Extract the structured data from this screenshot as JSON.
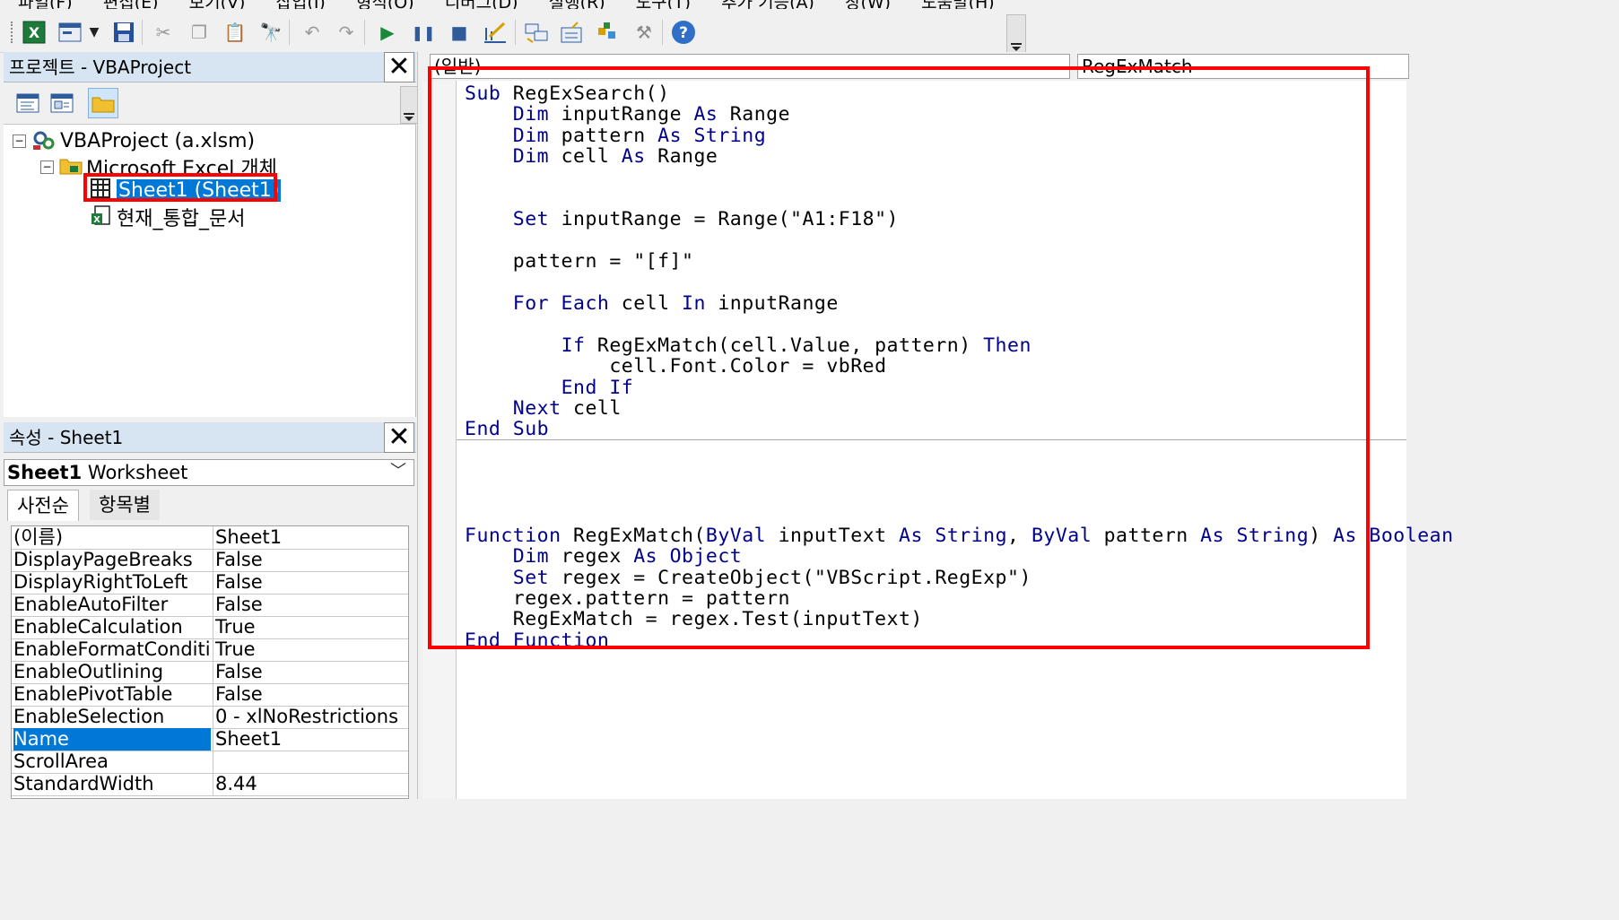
{
  "menubar": {
    "items": [
      "파일(F)",
      "편집(E)",
      "보기(V)",
      "삽입(I)",
      "형식(O)",
      "디버그(D)",
      "실행(R)",
      "도구(T)",
      "추가 기능(A)",
      "창(W)",
      "도움말(H)"
    ]
  },
  "toolbar": {
    "buttons": [
      {
        "icon": "excel-icon"
      },
      {
        "icon": "insert-userform-icon"
      },
      {
        "icon": "dropdown-icon"
      },
      {
        "icon": "save-icon"
      },
      {
        "icon": "cut-icon"
      },
      {
        "icon": "copy-icon"
      },
      {
        "icon": "paste-icon"
      },
      {
        "icon": "find-icon"
      },
      {
        "icon": "undo-icon"
      },
      {
        "icon": "redo-icon"
      },
      {
        "icon": "run-icon"
      },
      {
        "icon": "break-icon"
      },
      {
        "icon": "reset-icon"
      },
      {
        "icon": "design-mode-icon"
      },
      {
        "icon": "project-explorer-icon"
      },
      {
        "icon": "properties-window-icon"
      },
      {
        "icon": "object-browser-icon"
      },
      {
        "icon": "toolbox-icon"
      },
      {
        "icon": "help-icon"
      }
    ]
  },
  "project": {
    "title": "프로젝트 - VBAProject",
    "tree": {
      "root": "VBAProject (a.xlsm)",
      "folder": "Microsoft Excel 개체",
      "sheet": "Sheet1 (Sheet1)",
      "workbook": "현재_통합_문서"
    }
  },
  "properties": {
    "title": "속성 - Sheet1",
    "object_bold": "Sheet1",
    "object_type": "Worksheet",
    "tabs": [
      "사전순",
      "항목별"
    ],
    "rows": [
      {
        "name": "(이름)",
        "value": "Sheet1"
      },
      {
        "name": "DisplayPageBreaks",
        "value": "False"
      },
      {
        "name": "DisplayRightToLeft",
        "value": "False"
      },
      {
        "name": "EnableAutoFilter",
        "value": "False"
      },
      {
        "name": "EnableCalculation",
        "value": "True"
      },
      {
        "name": "EnableFormatConditi",
        "value": "True"
      },
      {
        "name": "EnableOutlining",
        "value": "False"
      },
      {
        "name": "EnablePivotTable",
        "value": "False"
      },
      {
        "name": "EnableSelection",
        "value": "0 - xlNoRestrictions"
      },
      {
        "name": "Name",
        "value": "Sheet1"
      },
      {
        "name": "ScrollArea",
        "value": ""
      },
      {
        "name": "StandardWidth",
        "value": "8.44"
      }
    ]
  },
  "code": {
    "object_combo": "(일반)",
    "proc_combo": "RegExMatch",
    "lines": [
      [
        [
          "kw",
          "Sub"
        ],
        [
          "t",
          " RegExSearch()"
        ]
      ],
      [
        [
          "t",
          "    "
        ],
        [
          "kw",
          "Dim"
        ],
        [
          "t",
          " inputRange "
        ],
        [
          "kw",
          "As"
        ],
        [
          "t",
          " Range"
        ]
      ],
      [
        [
          "t",
          "    "
        ],
        [
          "kw",
          "Dim"
        ],
        [
          "t",
          " pattern "
        ],
        [
          "kw",
          "As"
        ],
        [
          "t",
          " "
        ],
        [
          "kw",
          "String"
        ]
      ],
      [
        [
          "t",
          "    "
        ],
        [
          "kw",
          "Dim"
        ],
        [
          "t",
          " cell "
        ],
        [
          "kw",
          "As"
        ],
        [
          "t",
          " Range"
        ]
      ],
      [
        [
          "t",
          ""
        ]
      ],
      [
        [
          "t",
          ""
        ]
      ],
      [
        [
          "t",
          "    "
        ],
        [
          "kw",
          "Set"
        ],
        [
          "t",
          " inputRange = Range(\"A1:F18\")"
        ]
      ],
      [
        [
          "t",
          ""
        ]
      ],
      [
        [
          "t",
          "    pattern = \"[f]\""
        ]
      ],
      [
        [
          "t",
          ""
        ]
      ],
      [
        [
          "t",
          "    "
        ],
        [
          "kw",
          "For Each"
        ],
        [
          "t",
          " cell "
        ],
        [
          "kw",
          "In"
        ],
        [
          "t",
          " inputRange"
        ]
      ],
      [
        [
          "t",
          ""
        ]
      ],
      [
        [
          "t",
          "        "
        ],
        [
          "kw",
          "If"
        ],
        [
          "t",
          " RegExMatch(cell.Value, pattern) "
        ],
        [
          "kw",
          "Then"
        ]
      ],
      [
        [
          "t",
          "            cell.Font.Color = vbRed"
        ]
      ],
      [
        [
          "t",
          "        "
        ],
        [
          "kw",
          "End If"
        ]
      ],
      [
        [
          "t",
          "    "
        ],
        [
          "kw",
          "Next"
        ],
        [
          "t",
          " cell"
        ]
      ],
      [
        [
          "kw",
          "End Sub"
        ]
      ],
      [
        [
          "t",
          ""
        ]
      ],
      [
        [
          "t",
          ""
        ]
      ],
      [
        [
          "kw",
          "Function"
        ],
        [
          "t",
          " RegExMatch("
        ],
        [
          "kw",
          "ByVal"
        ],
        [
          "t",
          " inputText "
        ],
        [
          "kw",
          "As"
        ],
        [
          "t",
          " "
        ],
        [
          "kw",
          "String"
        ],
        [
          "t",
          ", "
        ],
        [
          "kw",
          "ByVal"
        ],
        [
          "t",
          " pattern "
        ],
        [
          "kw",
          "As"
        ],
        [
          "t",
          " "
        ],
        [
          "kw",
          "String"
        ],
        [
          "t",
          ") "
        ],
        [
          "kw",
          "As"
        ],
        [
          "t",
          " "
        ],
        [
          "kw",
          "Boolean"
        ]
      ],
      [
        [
          "t",
          "    "
        ],
        [
          "kw",
          "Dim"
        ],
        [
          "t",
          " regex "
        ],
        [
          "kw",
          "As"
        ],
        [
          "t",
          " "
        ],
        [
          "kw",
          "Object"
        ]
      ],
      [
        [
          "t",
          "    "
        ],
        [
          "kw",
          "Set"
        ],
        [
          "t",
          " regex = CreateObject(\"VBScript.RegExp\")"
        ]
      ],
      [
        [
          "t",
          "    regex.pattern = pattern"
        ]
      ],
      [
        [
          "t",
          "    RegExMatch = regex.Test(inputText)"
        ]
      ],
      [
        [
          "kw",
          "End Function"
        ]
      ]
    ]
  },
  "colors": {
    "keyword": "#00008b",
    "selection": "#0078d7",
    "highlight_box": "#ff0000",
    "panel_title": "#d7e4f2"
  }
}
